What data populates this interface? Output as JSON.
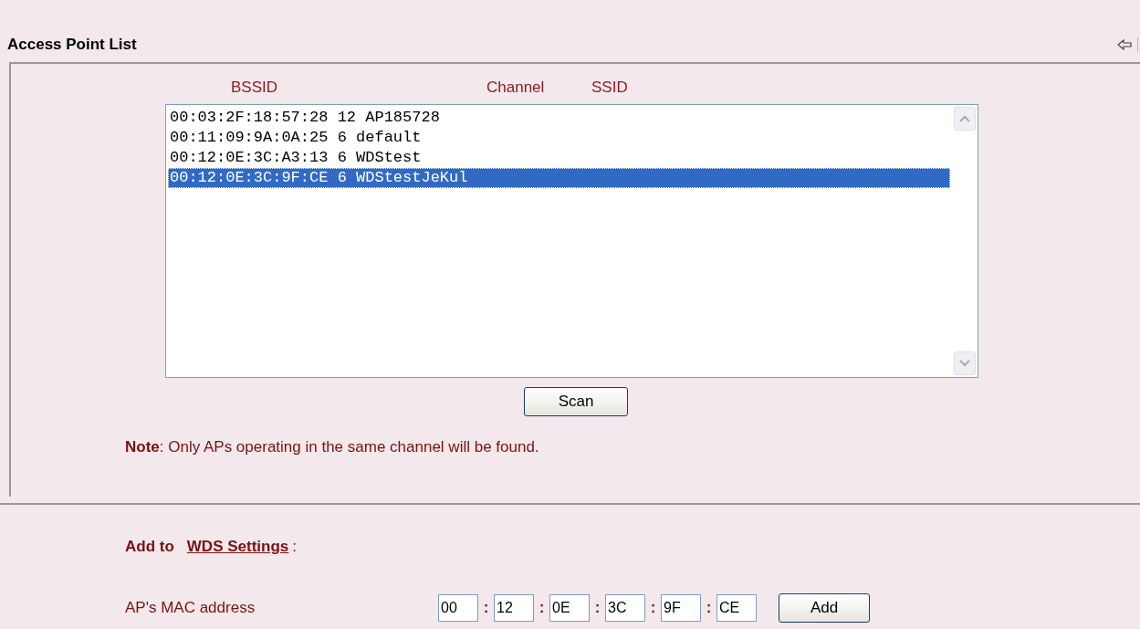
{
  "title": "Access Point List",
  "columns": [
    "BSSID",
    "Channel",
    "SSID"
  ],
  "access_points": [
    {
      "bssid": "00:03:2F:18:57:28",
      "channel": "12",
      "ssid": "AP185728",
      "selected": false
    },
    {
      "bssid": "00:11:09:9A:0A:25",
      "channel": "6",
      "ssid": "default",
      "selected": false
    },
    {
      "bssid": "00:12:0E:3C:A3:13",
      "channel": "6",
      "ssid": "WDStest",
      "selected": false
    },
    {
      "bssid": "00:12:0E:3C:9F:CE",
      "channel": "6",
      "ssid": "WDStestJeKul",
      "selected": true
    }
  ],
  "scan_button": "Scan",
  "note": "**Note**: Only APs operating in the same channel will be found.",
  "add_to": {
    "label": "Add to",
    "link": "WDS Settings",
    "suffix": ":"
  },
  "mac": {
    "label": "AP's MAC address",
    "octets": [
      "00",
      "12",
      "0E",
      "3C",
      "9F",
      "CE"
    ],
    "separator": ":",
    "button": "Add"
  }
}
